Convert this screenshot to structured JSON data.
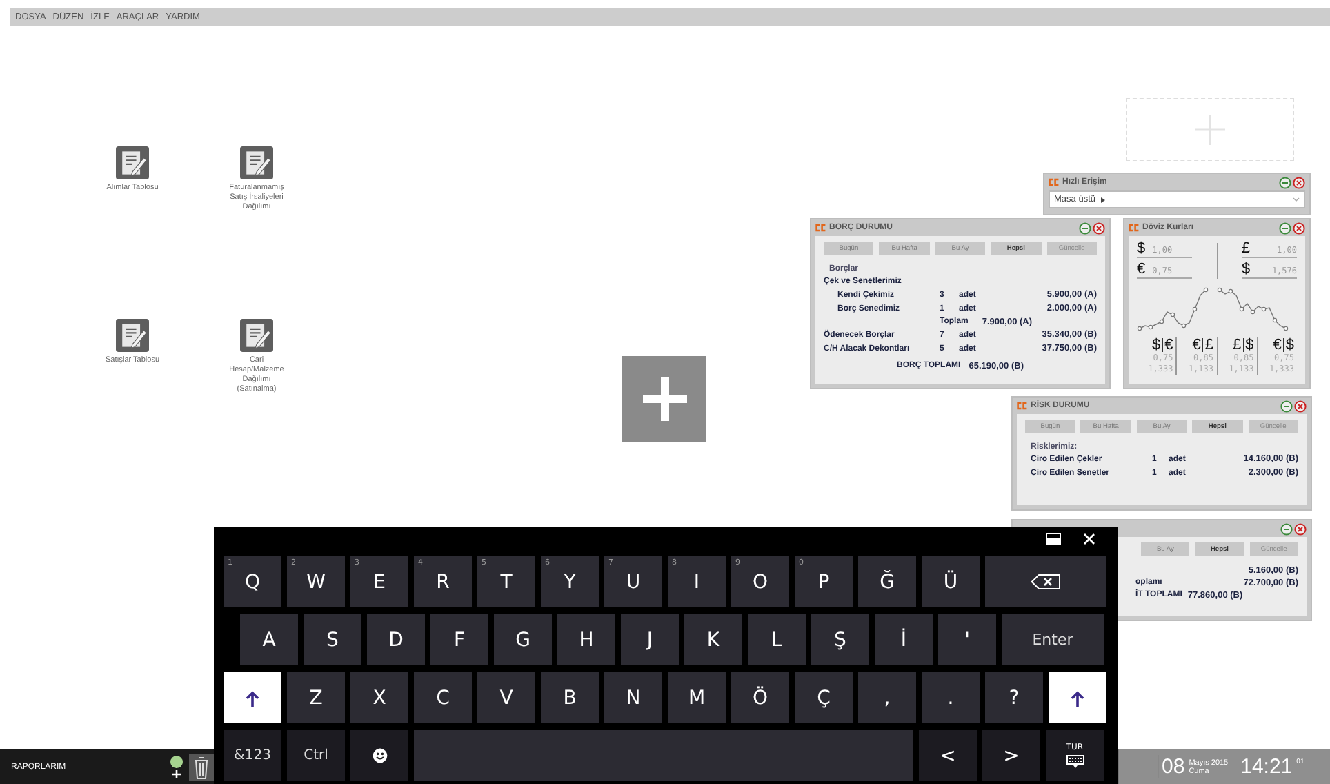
{
  "menu": [
    {
      "label": "DOSYA"
    },
    {
      "label": "DÜZEN"
    },
    {
      "label": "İZLE"
    },
    {
      "label": "ARAÇLAR"
    },
    {
      "label": "YARDIM"
    }
  ],
  "desktop_icons": [
    {
      "label": "Alımlar Tablosu"
    },
    {
      "label": "Faturalanmamış Satış İrsaliyeleri Dağılımı"
    },
    {
      "label": "Satışlar Tablosu"
    },
    {
      "label": "Cari Hesap/Malzeme Dağılımı (Satınalma)"
    }
  ],
  "hizli_erisim": {
    "title": "Hızlı Erişim",
    "location": "Masa üstü"
  },
  "borc_durumu": {
    "title": "BORÇ DURUMU",
    "periods": [
      {
        "label": "Bugün",
        "selected": false
      },
      {
        "label": "Bu Hafta",
        "selected": false
      },
      {
        "label": "Bu Ay",
        "selected": false
      },
      {
        "label": "Hepsi",
        "selected": true
      }
    ],
    "update_button": "Güncelle",
    "caption": "Borçlar",
    "lines": [
      {
        "kind": "group",
        "label": "Çek ve Senetlerimiz",
        "children": [
          {
            "label": "Kendi Çekimiz",
            "count": "3",
            "unit": "adet",
            "amount": "5.900,00 (A)"
          },
          {
            "label": "Borç Senedimiz",
            "count": "1",
            "unit": "adet",
            "amount": "2.000,00 (A)"
          }
        ],
        "total_label": "Toplam",
        "total_amount": "7.900,00 (A)"
      },
      {
        "kind": "item",
        "label": "Ödenecek Borçlar",
        "count": "7",
        "unit": "adet",
        "amount": "35.340,00 (B)"
      },
      {
        "kind": "item",
        "label": "C/H Alacak Dekontları",
        "count": "5",
        "unit": "adet",
        "amount": "37.750,00 (B)"
      },
      {
        "kind": "total",
        "label": "BORÇ TOPLAMI",
        "amount": "65.190,00 (B)"
      }
    ]
  },
  "doviz_kurlari": {
    "title": "Döviz Kurları",
    "left": [
      {
        "symbol": "$",
        "value": "1,00"
      },
      {
        "symbol": "€",
        "value": "0,75"
      }
    ],
    "right": [
      {
        "symbol": "£",
        "value": "1,00"
      },
      {
        "symbol": "$",
        "value": "1,576"
      }
    ],
    "pairs": [
      {
        "base": "$",
        "quote": "€",
        "rate": "0,75",
        "inverse": "1,333"
      },
      {
        "base": "€",
        "quote": "£",
        "rate": "0,85",
        "inverse": "1,133"
      },
      {
        "base": "£",
        "quote": "$",
        "rate": "0,85",
        "inverse": "1,133"
      },
      {
        "base": "€",
        "quote": "$",
        "rate": "0,75",
        "inverse": "1,333"
      }
    ]
  },
  "risk_durumu": {
    "title": "RİSK DURUMU",
    "periods": [
      {
        "label": "Bugün",
        "selected": false
      },
      {
        "label": "Bu Hafta",
        "selected": false
      },
      {
        "label": "Bu Ay",
        "selected": false
      },
      {
        "label": "Hepsi",
        "selected": true
      }
    ],
    "update_button": "Güncelle",
    "caption": "Risklerimiz:",
    "items": [
      {
        "label": "Ciro Edilen Çekler",
        "count": "1",
        "unit": "adet",
        "amount": "14.160,00 (B)"
      },
      {
        "label": "Ciro Edilen Senetler",
        "count": "1",
        "unit": "adet",
        "amount": "2.300,00 (B)"
      }
    ]
  },
  "nakit_durumu": {
    "periods": [
      {
        "label": "Bu Ay",
        "selected": false
      },
      {
        "label": "Hepsi",
        "selected": true
      }
    ],
    "update_button": "Güncelle",
    "lines": [
      {
        "kind": "item",
        "amount": "5.160,00 (B)"
      },
      {
        "kind": "item",
        "label": "oplamı",
        "amount": "72.700,00 (B)"
      },
      {
        "kind": "total",
        "label": "İT TOPLAMI",
        "amount": "77.860,00 (B)"
      }
    ]
  },
  "keyboard": {
    "rows": [
      [
        {
          "kind": "char",
          "label": "Q",
          "hint": "1"
        },
        {
          "kind": "char",
          "label": "W",
          "hint": "2"
        },
        {
          "kind": "char",
          "label": "E",
          "hint": "3"
        },
        {
          "kind": "char",
          "label": "R",
          "hint": "4"
        },
        {
          "kind": "char",
          "label": "T",
          "hint": "5"
        },
        {
          "kind": "char",
          "label": "Y",
          "hint": "6"
        },
        {
          "kind": "char",
          "label": "U",
          "hint": "7"
        },
        {
          "kind": "char",
          "label": "I",
          "hint": "8"
        },
        {
          "kind": "char",
          "label": "O",
          "hint": "9"
        },
        {
          "kind": "char",
          "label": "P",
          "hint": "0"
        },
        {
          "kind": "char",
          "label": "Ğ"
        },
        {
          "kind": "char",
          "label": "Ü"
        },
        {
          "kind": "backspace"
        }
      ],
      [
        {
          "kind": "char",
          "label": "A"
        },
        {
          "kind": "char",
          "label": "S"
        },
        {
          "kind": "char",
          "label": "D"
        },
        {
          "kind": "char",
          "label": "F"
        },
        {
          "kind": "char",
          "label": "G"
        },
        {
          "kind": "char",
          "label": "H"
        },
        {
          "kind": "char",
          "label": "J"
        },
        {
          "kind": "char",
          "label": "K"
        },
        {
          "kind": "char",
          "label": "L"
        },
        {
          "kind": "char",
          "label": "Ş"
        },
        {
          "kind": "char",
          "label": "İ"
        },
        {
          "kind": "char",
          "label": "'"
        },
        {
          "kind": "enter",
          "label": "Enter"
        }
      ],
      [
        {
          "kind": "shift",
          "on": true
        },
        {
          "kind": "char",
          "label": "Z"
        },
        {
          "kind": "char",
          "label": "X"
        },
        {
          "kind": "char",
          "label": "C"
        },
        {
          "kind": "char",
          "label": "V"
        },
        {
          "kind": "char",
          "label": "B"
        },
        {
          "kind": "char",
          "label": "N"
        },
        {
          "kind": "char",
          "label": "M"
        },
        {
          "kind": "char",
          "label": "Ö"
        },
        {
          "kind": "char",
          "label": "Ç"
        },
        {
          "kind": "char",
          "label": ","
        },
        {
          "kind": "char",
          "label": "."
        },
        {
          "kind": "char",
          "label": "?"
        },
        {
          "kind": "shift",
          "on": true
        }
      ]
    ],
    "bottom_left": [
      {
        "kind": "mode",
        "label": "&123"
      },
      {
        "kind": "mode",
        "label": "Ctrl"
      },
      {
        "kind": "emoji"
      }
    ],
    "bottom_right": [
      {
        "kind": "arrow",
        "label": "<"
      },
      {
        "kind": "arrow",
        "label": ">"
      },
      {
        "kind": "language",
        "label": "TUR"
      }
    ]
  },
  "taskbar": {
    "label": "RAPORLARIM"
  },
  "clock": {
    "day": "08",
    "month_year": "Mayıs 2015",
    "weekday": "Cuma",
    "time": "14:21",
    "seconds": "01"
  }
}
